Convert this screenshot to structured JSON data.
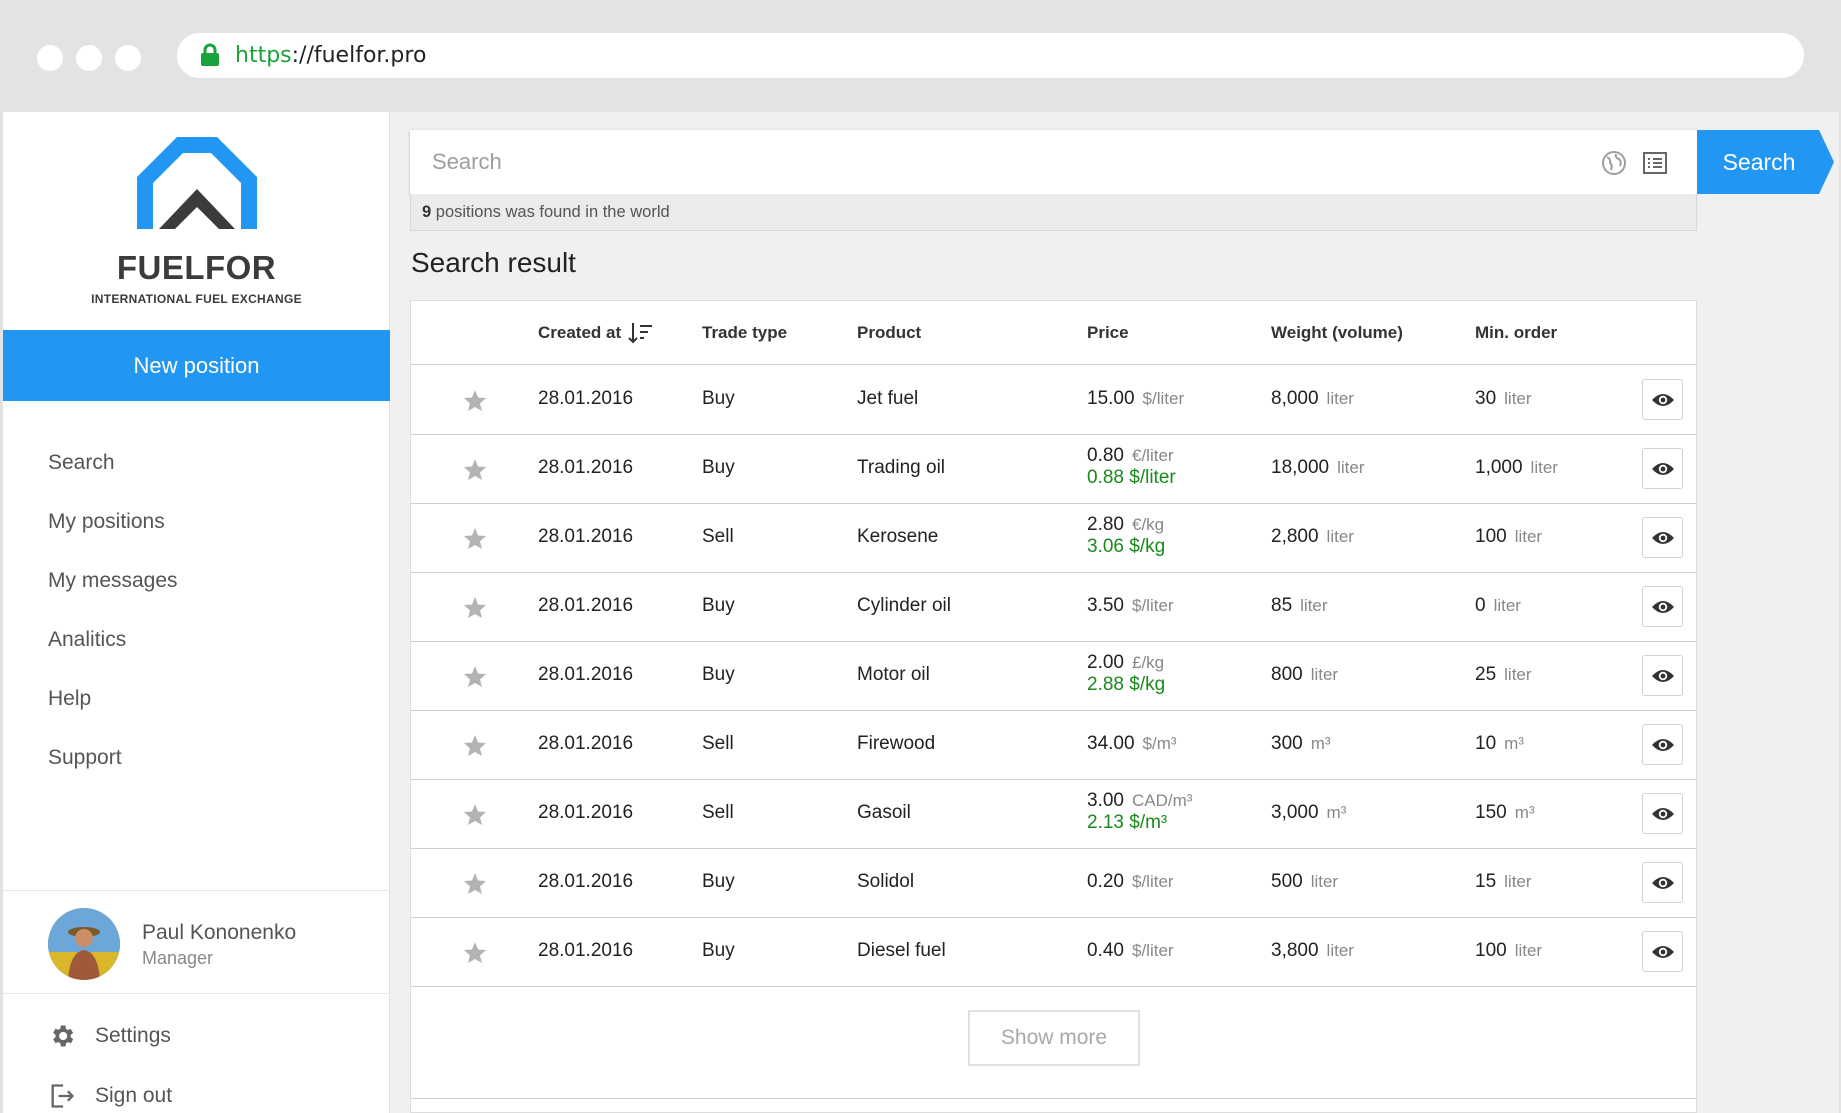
{
  "browser": {
    "url_scheme": "https",
    "url_rest": "://fuelfor.pro"
  },
  "sidebar": {
    "logo_name": "FUELFOR",
    "logo_tagline": "INTERNATIONAL FUEL EXCHANGE",
    "new_position_label": "New position",
    "nav": [
      {
        "label": "Search"
      },
      {
        "label": "My positions"
      },
      {
        "label": "My messages"
      },
      {
        "label": "Analitics"
      },
      {
        "label": "Help"
      },
      {
        "label": "Support"
      }
    ],
    "user": {
      "name": "Paul Kononenko",
      "role": "Manager"
    },
    "settings_label": "Settings",
    "signout_label": "Sign out"
  },
  "search": {
    "placeholder": "Search",
    "button_label": "Search",
    "found_count": "9",
    "found_text": " positions was found in the world"
  },
  "results": {
    "title": "Search result",
    "columns": {
      "created": "Created at",
      "trade": "Trade type",
      "product": "Product",
      "price": "Price",
      "weight": "Weight (volume)",
      "min_order": "Min. order"
    },
    "rows": [
      {
        "date": "28.01.2016",
        "trade": "Buy",
        "product": "Jet fuel",
        "price": "15.00",
        "price_unit": "$/liter",
        "conv": "",
        "weight": "8,000",
        "weight_unit": "liter",
        "min": "30",
        "min_unit": "liter"
      },
      {
        "date": "28.01.2016",
        "trade": "Buy",
        "product": "Trading oil",
        "price": "0.80",
        "price_unit": "€/liter",
        "conv": "0.88 $/liter",
        "weight": "18,000",
        "weight_unit": "liter",
        "min": "1,000",
        "min_unit": "liter"
      },
      {
        "date": "28.01.2016",
        "trade": "Sell",
        "product": "Kerosene",
        "price": "2.80",
        "price_unit": "€/kg",
        "conv": "3.06 $/kg",
        "weight": "2,800",
        "weight_unit": "liter",
        "min": "100",
        "min_unit": "liter"
      },
      {
        "date": "28.01.2016",
        "trade": "Buy",
        "product": "Cylinder oil",
        "price": "3.50",
        "price_unit": "$/liter",
        "conv": "",
        "weight": "85",
        "weight_unit": "liter",
        "min": "0",
        "min_unit": "liter"
      },
      {
        "date": "28.01.2016",
        "trade": "Buy",
        "product": "Motor oil",
        "price": "2.00",
        "price_unit": "£/kg",
        "conv": "2.88 $/kg",
        "weight": "800",
        "weight_unit": "liter",
        "min": "25",
        "min_unit": "liter"
      },
      {
        "date": "28.01.2016",
        "trade": "Sell",
        "product": "Firewood",
        "price": "34.00",
        "price_unit": "$/m³",
        "conv": "",
        "weight": "300",
        "weight_unit": "m³",
        "min": "10",
        "min_unit": "m³"
      },
      {
        "date": "28.01.2016",
        "trade": "Sell",
        "product": "Gasoil",
        "price": "3.00",
        "price_unit": "CAD/m³",
        "conv": "2.13 $/m³",
        "weight": "3,000",
        "weight_unit": "m³",
        "min": "150",
        "min_unit": "m³"
      },
      {
        "date": "28.01.2016",
        "trade": "Buy",
        "product": "Solidol",
        "price": "0.20",
        "price_unit": "$/liter",
        "conv": "",
        "weight": "500",
        "weight_unit": "liter",
        "min": "15",
        "min_unit": "liter"
      },
      {
        "date": "28.01.2016",
        "trade": "Buy",
        "product": "Diesel fuel",
        "price": "0.40",
        "price_unit": "$/liter",
        "conv": "",
        "weight": "3,800",
        "weight_unit": "liter",
        "min": "100",
        "min_unit": "liter"
      }
    ],
    "show_more_label": "Show more"
  },
  "colors": {
    "accent": "#2196f3",
    "converted_price": "#1a8a1a",
    "lock": "#1aa33a"
  },
  "icons": [
    "lock-icon",
    "globe-icon",
    "list-view-icon",
    "sort-descending-icon",
    "star-icon",
    "eye-icon",
    "gear-icon",
    "sign-out-icon"
  ]
}
